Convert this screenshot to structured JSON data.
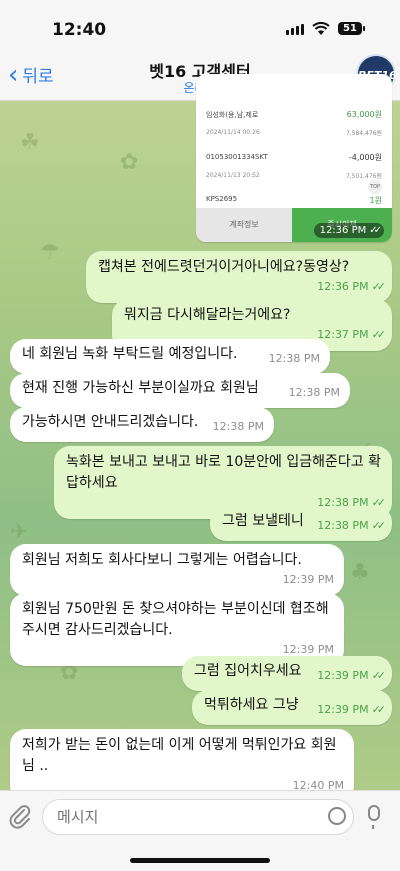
{
  "status_bar": {
    "time": "12:40",
    "battery": "51"
  },
  "header": {
    "back_label": "뒤로",
    "title": "벳16 고객센터",
    "subtitle": "온라인",
    "avatar_text": "BET16"
  },
  "image_message": {
    "rows": [
      {
        "label": "임성화(용,남,제로",
        "amount": "63,000원",
        "amount_color": "#3f9a45"
      },
      {
        "label": "2024/11/14 00:26",
        "amount": "7,584,476원"
      },
      {
        "label": "01053001334SKT",
        "amount": "-4,000원"
      },
      {
        "label": "2024/11/13 20:52",
        "amount": "7,501,476원"
      },
      {
        "label": "KPS2695",
        "amount": "1원",
        "amount_color": "#3f9a45"
      }
    ],
    "top_badge": "TOP",
    "btn_left": "계좌정보",
    "btn_right": "즉시이체",
    "time": "12:36 PM"
  },
  "messages": [
    {
      "dir": "out",
      "text": "캡쳐본 전에드렷던거이거아니에요?동영상?",
      "time": "12:36 PM"
    },
    {
      "dir": "out",
      "text": "뭐지금 다시해달라는거에요?",
      "time": "12:37 PM"
    },
    {
      "dir": "in",
      "text": "네 회원님 녹화 부탁드릴 예정입니다.",
      "time": "12:38 PM"
    },
    {
      "dir": "in",
      "text": "현재 진행 가능하신 부분이실까요 회원님",
      "time": "12:38 PM"
    },
    {
      "dir": "in",
      "text": "가능하시면 안내드리겠습니다.",
      "time": "12:38 PM"
    },
    {
      "dir": "out",
      "text": "녹화본 보내고 보내고 바로 10분안에 입금해준다고 확답하세요",
      "time": "12:38 PM"
    },
    {
      "dir": "out",
      "text": "그럼 보낼테니",
      "time": "12:38 PM"
    },
    {
      "dir": "in",
      "text": "회원님 저희도 회사다보니 그렇게는 어렵습니다.",
      "time": "12:39 PM"
    },
    {
      "dir": "in",
      "text": "회원님 750만원 돈 찾으셔야하는 부분이신데 협조해주시면 감사드리겠습니다.",
      "time": "12:39 PM"
    },
    {
      "dir": "out",
      "text": "그럼 집어치우세요",
      "time": "12:39 PM"
    },
    {
      "dir": "out",
      "text": "먹튀하세요 그냥",
      "time": "12:39 PM"
    },
    {
      "dir": "in",
      "text": "저희가 받는 돈이 없는데 이게 어떻게 먹튀인가요 회원님 ..",
      "time": "12:40 PM"
    }
  ],
  "ticks": "✓✓",
  "composer": {
    "placeholder": "메시지"
  },
  "colors": {
    "outgoing_bubble": "#e2f7c9",
    "incoming_bubble": "#ffffff",
    "accent": "#2f7de1"
  }
}
